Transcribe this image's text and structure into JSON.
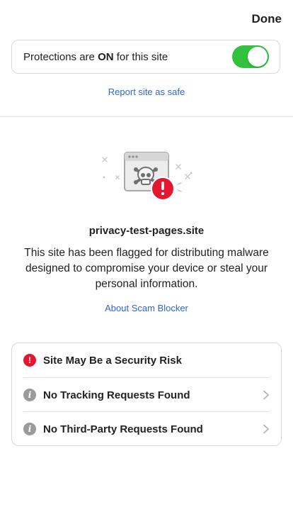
{
  "header": {
    "done_label": "Done"
  },
  "protection": {
    "text_prefix": "Protections are ",
    "text_state": "ON",
    "text_suffix": " for this site",
    "enabled": true,
    "toggle_color": "#31c13e"
  },
  "report_link": "Report site as safe",
  "alert": {
    "site": "privacy-test-pages.site",
    "description": "This site has been flagged for distributing malware designed to compromise your device or steal your personal information.",
    "about_link": "About Scam Blocker"
  },
  "status_items": [
    {
      "label": "Site May Be a Security Risk",
      "icon": "alert-icon",
      "icon_color": "#e3172f",
      "has_chevron": false
    },
    {
      "label": "No Tracking Requests Found",
      "icon": "info-icon",
      "icon_color": "#9a9a9a",
      "has_chevron": true
    },
    {
      "label": "No Third-Party Requests Found",
      "icon": "info-icon",
      "icon_color": "#9a9a9a",
      "has_chevron": true
    }
  ],
  "colors": {
    "link": "#2b67d9",
    "danger": "#e3172f"
  }
}
